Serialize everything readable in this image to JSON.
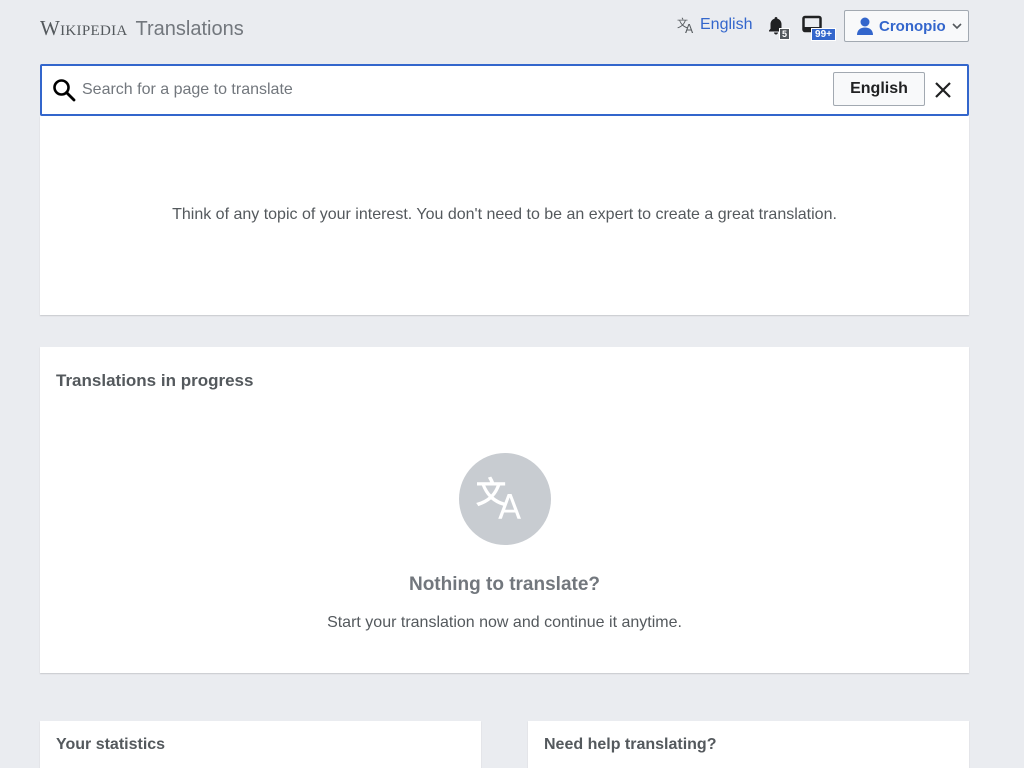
{
  "header": {
    "wordmark": "Wikipedia",
    "section_title": "Translations",
    "language_label": "English",
    "notifications_count": "5",
    "notices_count": "99+",
    "user_name": "Cronopio"
  },
  "search": {
    "placeholder": "Search for a page to translate",
    "value": "",
    "source_language": "English"
  },
  "suggestions": {
    "message": "Think of any topic of your interest. You don't need to be an expert to create a great translation."
  },
  "in_progress": {
    "title": "Translations in progress",
    "empty_title": "Nothing to translate?",
    "empty_subtitle": "Start your translation now and continue it anytime."
  },
  "stats": {
    "title": "Your statistics"
  },
  "help": {
    "title": "Need help translating?"
  },
  "colors": {
    "accent": "#3366cc",
    "background": "#eaecf0",
    "icon_gray": "#c8ccd1"
  },
  "icons": [
    "translate-icon",
    "bell-icon",
    "tray-icon",
    "user-icon",
    "chevron-down-icon",
    "search-icon",
    "close-icon"
  ]
}
